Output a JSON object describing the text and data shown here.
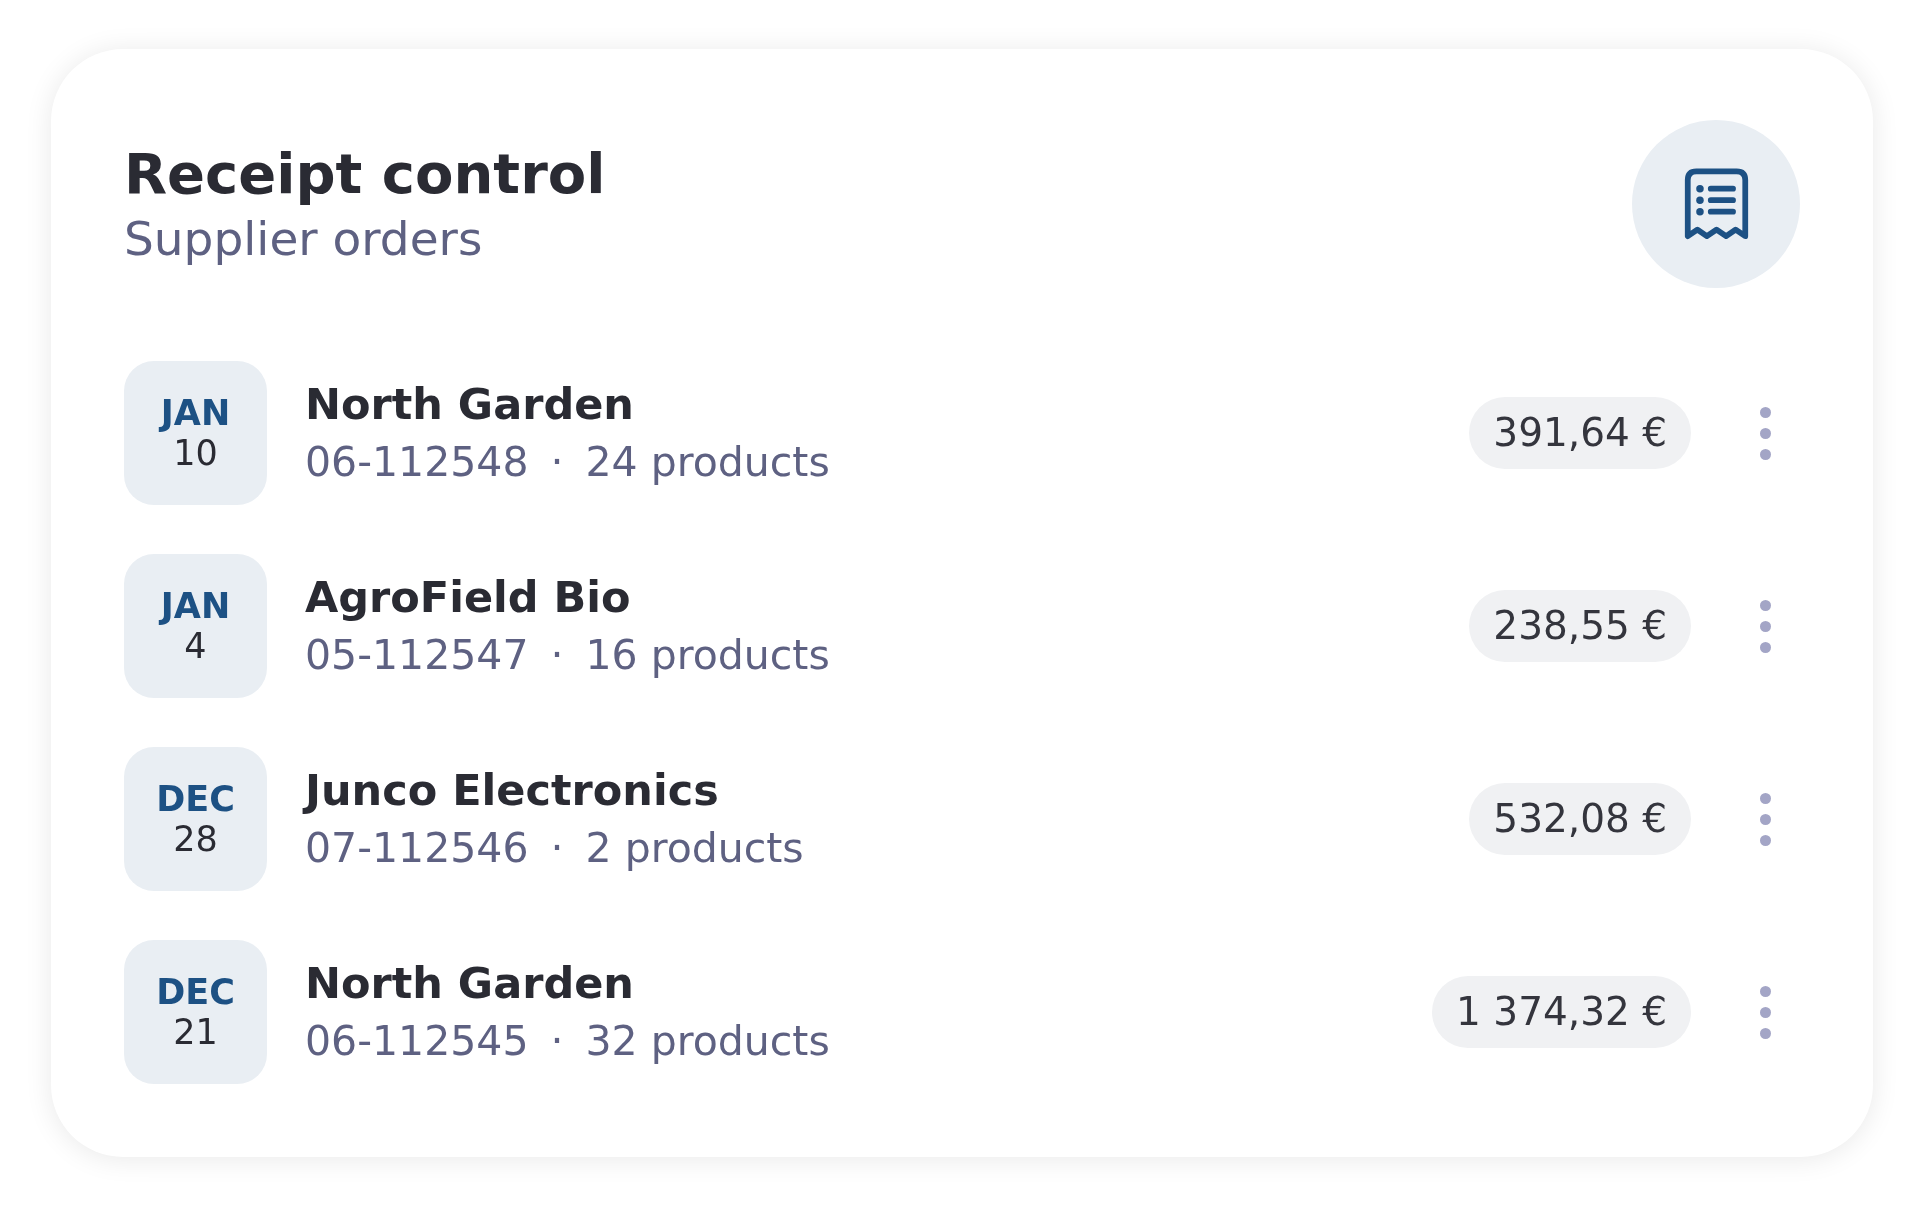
{
  "header": {
    "title": "Receipt control",
    "subtitle": "Supplier orders"
  },
  "orders": [
    {
      "month": "JAN",
      "day": "10",
      "supplier": "North Garden",
      "order_number": "06-112548",
      "separator": "·",
      "products": "24 products",
      "amount": "391,64 €"
    },
    {
      "month": "JAN",
      "day": "4",
      "supplier": "AgroField Bio",
      "order_number": "05-112547",
      "separator": "·",
      "products": "16 products",
      "amount": "238,55 €"
    },
    {
      "month": "DEC",
      "day": "28",
      "supplier": "Junco Electronics",
      "order_number": "07-112546",
      "separator": "·",
      "products": "2 products",
      "amount": "532,08 €"
    },
    {
      "month": "DEC",
      "day": "21",
      "supplier": "North Garden",
      "order_number": "06-112545",
      "separator": "·",
      "products": "32 products",
      "amount": "1 374,32 €"
    }
  ]
}
